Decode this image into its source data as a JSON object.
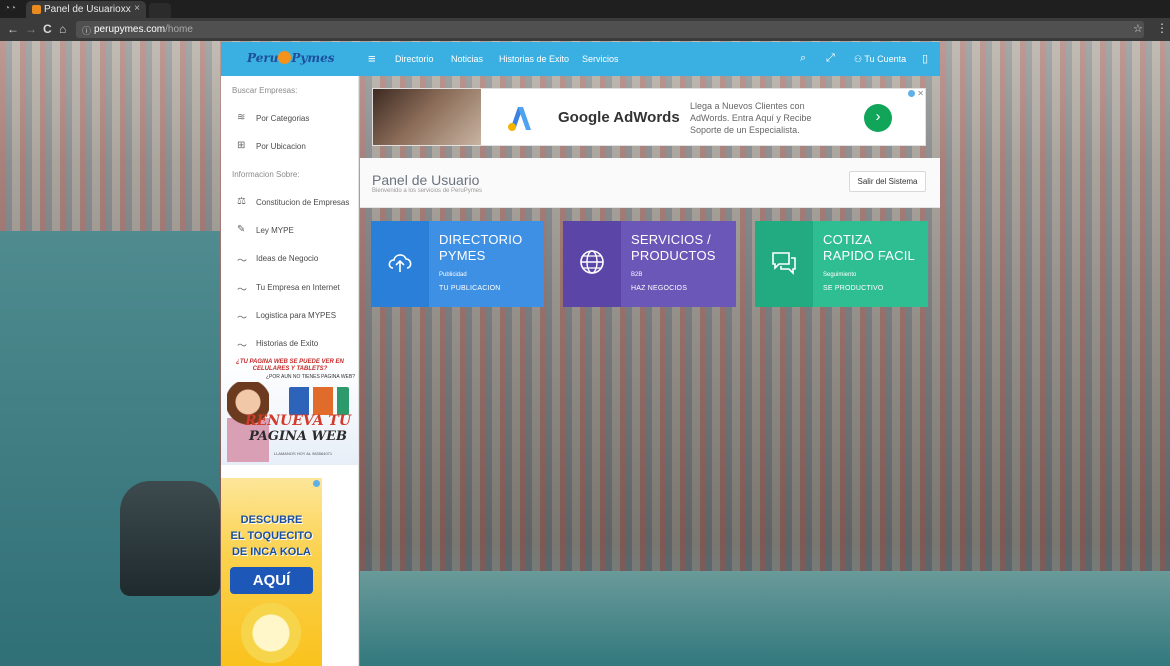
{
  "browser": {
    "tab_title": "Panel de Usuarioxx",
    "tab_close": "×",
    "url_domain": "perupymes.com",
    "url_path": "/home",
    "back": "←",
    "forward": "→",
    "reload": "C",
    "home": "⌂",
    "star": "☆",
    "menu": "⋮"
  },
  "topnav": {
    "logo_left": "Peru",
    "logo_right": "Pymes",
    "hamburger": "≡",
    "links": [
      "Directorio",
      "Noticias",
      "Historias de Exito",
      "Servicios"
    ],
    "search_icon": "⌕",
    "expand_icon": "⤢",
    "account": "Tu Cuenta",
    "phone_icon": "▯"
  },
  "sidebar": {
    "buscar_head": "Buscar Empresas:",
    "buscar_items": [
      {
        "label": "Por Categorias",
        "icon": "≋"
      },
      {
        "label": "Por Ubicacion",
        "icon": "⊞"
      }
    ],
    "info_head": "Informacion Sobre:",
    "info_items": [
      {
        "label": "Constitucion de Empresas",
        "icon": "⚖"
      },
      {
        "label": "Ley MYPE",
        "icon": "✎"
      },
      {
        "label": "Ideas de Negocio",
        "icon": "〜"
      },
      {
        "label": "Tu Empresa en Internet",
        "icon": "〜"
      },
      {
        "label": "Logistica para MYPES",
        "icon": "〜"
      },
      {
        "label": "Historias de Exito",
        "icon": "〜"
      }
    ]
  },
  "ads": {
    "web_top": "¿TU PAGINA WEB SE PUEDE VER EN CELULARES Y TABLETS?",
    "web_sub": "¿POR AUN NO TIENES PAGINA WEB?",
    "web_line1": "RENUEVA TU",
    "web_line2": "PAGINA WEB",
    "web_foot": "LLAMANOS HOY AL 983564071",
    "inka_l1": "DESCUBRE",
    "inka_l2": "EL TOQUECITO",
    "inka_l3": "DE INCA KOLA",
    "inka_btn": "AQUÍ",
    "banner_brand": "Google AdWords",
    "banner_desc": "Llega a Nuevos Clientes con AdWords. Entra Aquí y Recibe Soporte de un Especialista.",
    "banner_go": "›"
  },
  "panel": {
    "title": "Panel de Usuario",
    "subtitle": "Bienvenido a los servicios de PeruPymes",
    "logout": "Salir del Sistema"
  },
  "tiles": [
    {
      "title_1": "DIRECTORIO",
      "title_2": "PYMES",
      "small": "Publicidad",
      "action": "TU PUBLICACION",
      "icon": "cloud-upload-icon",
      "color": "#3e90e4"
    },
    {
      "title_1": "SERVICIOS /",
      "title_2": "PRODUCTOS",
      "small": "B2B",
      "action": "HAZ NEGOCIOS",
      "icon": "globe-icon",
      "color": "#6a57b8"
    },
    {
      "title_1": "COTIZA",
      "title_2": "RAPIDO FACIL",
      "small": "Seguimiento",
      "action": "SE PRODUCTIVO",
      "icon": "chat-icon",
      "color": "#2fbe91"
    }
  ]
}
